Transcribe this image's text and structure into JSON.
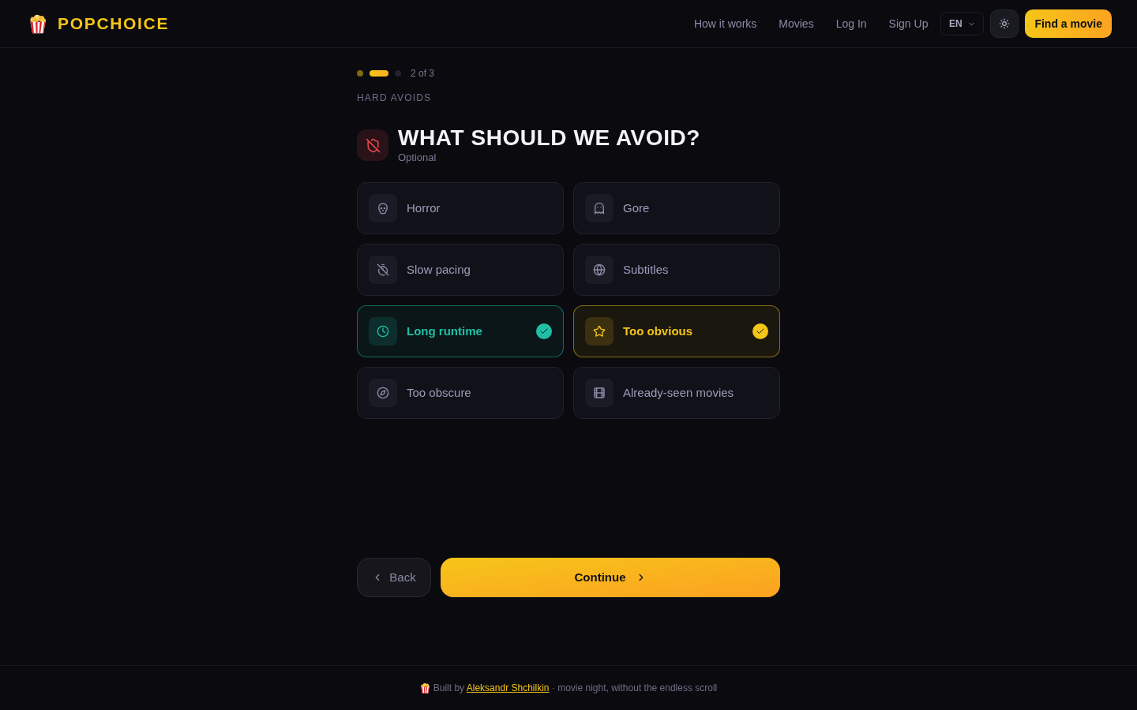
{
  "header": {
    "logo": "POPCHOICE",
    "nav": [
      "How it works",
      "Movies",
      "Log In",
      "Sign Up"
    ],
    "language": "EN",
    "cta": "Find a movie"
  },
  "progress": {
    "steps": [
      {
        "done": true,
        "selected": false
      },
      {
        "done": false,
        "selected": true
      },
      {
        "done": false,
        "selected": false
      }
    ],
    "label": "2 of 3"
  },
  "step": {
    "eyebrow": "HARD AVOIDS",
    "title": "WHAT SHOULD WE AVOID?",
    "subtitle": "Optional"
  },
  "options": [
    {
      "label": "Horror",
      "selected": false
    },
    {
      "label": "Gore",
      "selected": false
    },
    {
      "label": "Slow pacing",
      "selected": false
    },
    {
      "label": "Subtitles",
      "selected": false
    },
    {
      "label": "Long runtime",
      "selected": true,
      "color": "#1fbfa5"
    },
    {
      "label": "Too obvious",
      "selected": true,
      "color": "#f5c518"
    },
    {
      "label": "Too obscure",
      "selected": false
    },
    {
      "label": "Already-seen movies",
      "selected": false
    }
  ],
  "actions": {
    "back": "Back",
    "continue": "Continue"
  },
  "footer": {
    "before": "Built by",
    "link": "Aleksandr Shchilkin",
    "after": "· movie night, without the endless scroll"
  }
}
